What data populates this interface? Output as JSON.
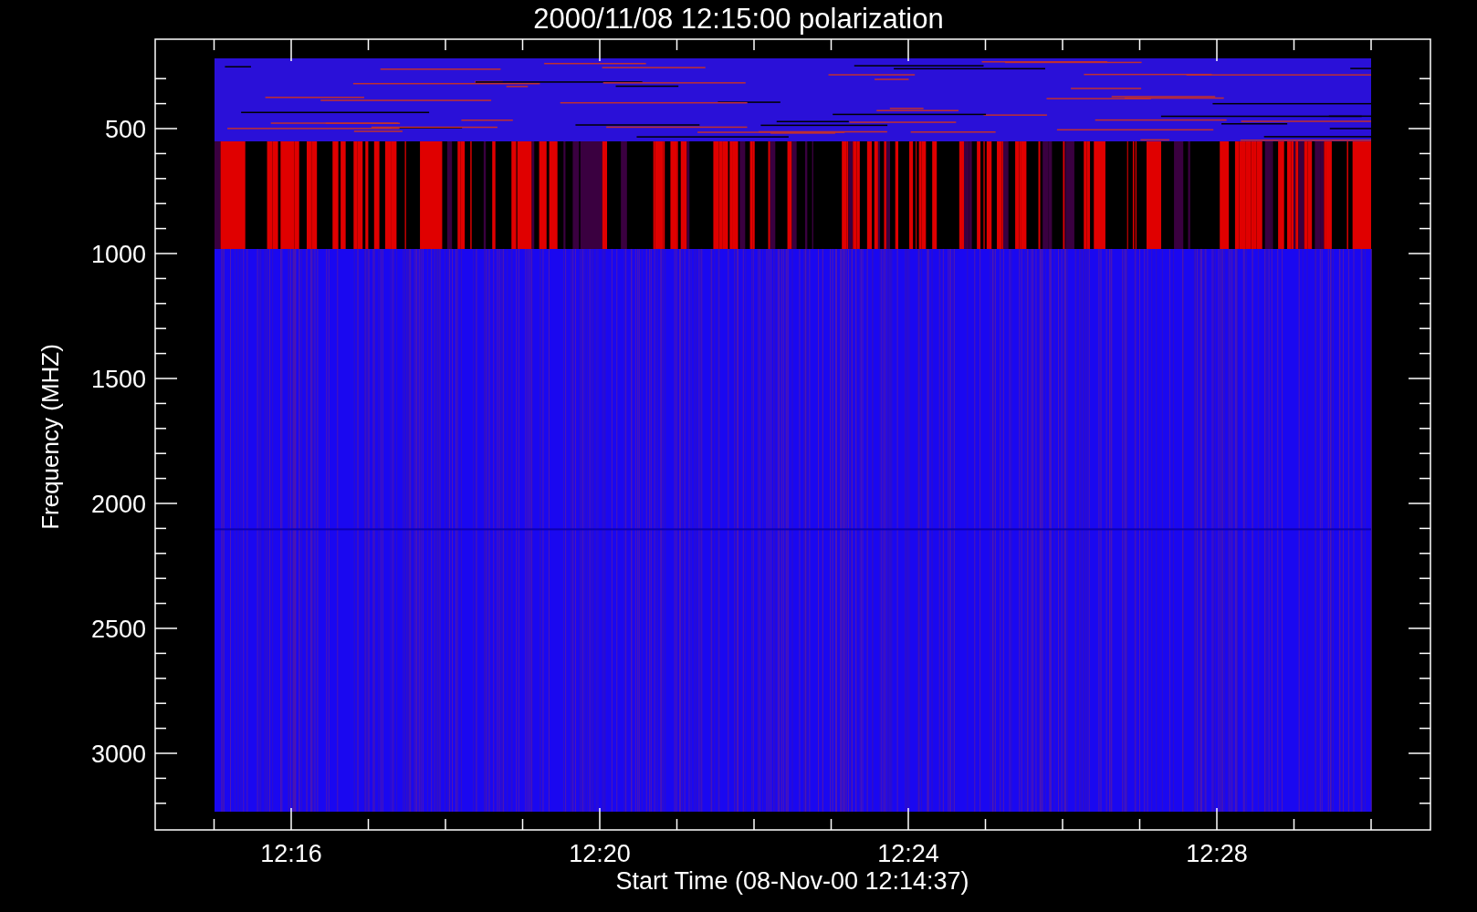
{
  "plot": {
    "title": "2000/11/08 12:15:00 polarization",
    "xlabel": "Start Time (08-Nov-00 12:14:37)",
    "ylabel": "Frequency (MHZ)",
    "yticks": [
      "500",
      "1000",
      "1500",
      "2000",
      "2500",
      "3000"
    ],
    "xticks": [
      "12:16",
      "12:20",
      "12:24",
      "12:28"
    ]
  }
}
